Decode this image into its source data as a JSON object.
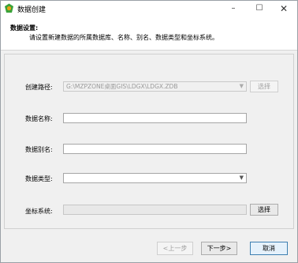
{
  "window": {
    "title": "数据创建",
    "controls": {
      "minimize": "–",
      "maximize": "☐",
      "close": "✕"
    }
  },
  "header": {
    "title": "数据设置:",
    "description": "请设置新建数据的所属数据库、名称、别名、数据类型和坐标系统。"
  },
  "form": {
    "path_label": "创建路径:",
    "path_value": "G:\\MZPZONE桌面GIS\\LDGX\\LDGX.ZDB",
    "path_browse": "选择",
    "name_label": "数据名称:",
    "name_value": "",
    "alias_label": "数据别名:",
    "alias_value": "",
    "type_label": "数据类型:",
    "type_value": "",
    "crs_label": "坐标系统:",
    "crs_value": "",
    "crs_browse": "选择"
  },
  "footer": {
    "prev": "<上一步",
    "next": "下一步>",
    "cancel": "取消"
  },
  "colors": {
    "accent": "#3c7fb1",
    "icon_green": "#3aa23a",
    "icon_orange": "#e8a317"
  }
}
